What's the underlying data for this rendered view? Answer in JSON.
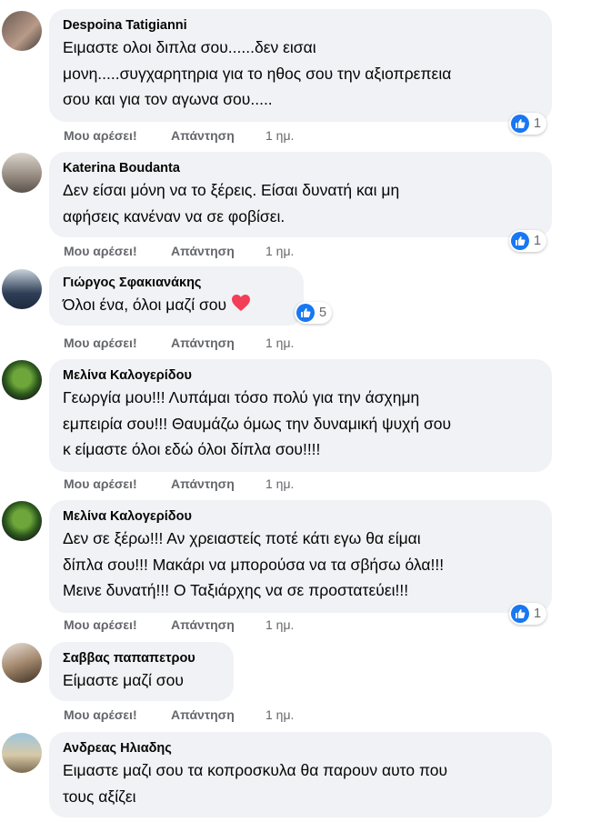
{
  "comments": [
    {
      "author": "Despoina Tatigianni",
      "lines": [
        "Ειμαστε ολοι διπλα σου......δεν εισαι",
        "μονη.....συγχαρητηρια για το ηθος σου την αξιοπρεπεια",
        "σου και για τον αγωνα σου....."
      ],
      "like_label": "Μου αρέσει!",
      "reply_label": "Απάντηση",
      "time": "1 ημ.",
      "reactions": "1"
    },
    {
      "author": "Katerina Boudanta",
      "lines": [
        "Δεν είσαι μόνη να το ξέρεις. Είσαι δυνατή και μη",
        "αφήσεις κανέναν να σε φοβίσει."
      ],
      "like_label": "Μου αρέσει!",
      "reply_label": "Απάντηση",
      "time": "1 ημ.",
      "reactions": "1"
    },
    {
      "author": "Γιώργος Σφακιανάκης",
      "lines": [
        "Όλοι ένα, όλοι μαζί σου"
      ],
      "like_label": "Μου αρέσει!",
      "reply_label": "Απάντηση",
      "time": "1 ημ.",
      "reactions": "5"
    },
    {
      "author": "Μελίνα Καλογερίδου",
      "lines": [
        "Γεωργία μου!!! Λυπάμαι τόσο πολύ για την άσχημη",
        "εμπειρία σου!!! Θαυμάζω όμως την δυναμική ψυχή σου",
        "κ είμαστε όλοι εδώ όλοι δίπλα σου!!!!"
      ],
      "like_label": "Μου αρέσει!",
      "reply_label": "Απάντηση",
      "time": "1 ημ."
    },
    {
      "author": "Μελίνα Καλογερίδου",
      "lines": [
        "Δεν σε ξέρω!!! Αν χρειαστείς ποτέ κάτι εγω θα είμαι",
        "δίπλα σου!!! Μακάρι να μπορούσα να τα σβήσω όλα!!!",
        "Μεινε δυνατή!!! Ο Ταξιάρχης να σε προστατεύει!!!"
      ],
      "like_label": "Μου αρέσει!",
      "reply_label": "Απάντηση",
      "time": "1 ημ.",
      "reactions": "1"
    },
    {
      "author": "Σαββας παπαπετρου",
      "lines": [
        "Είμαστε μαζί σου"
      ],
      "like_label": "Μου αρέσει!",
      "reply_label": "Απάντηση",
      "time": "1 ημ."
    },
    {
      "author": "Ανδρεας Ηλιαδης",
      "lines": [
        "Ειμαστε μαζι σου τα κοπροσκυλα θα παρουν αυτο που",
        "τους αξίζει"
      ]
    }
  ],
  "colors": {
    "bubble": "#f0f2f5",
    "like_blue": "#1877f2",
    "heart_red": "#f33e58",
    "muted_text": "#65676b"
  },
  "icons": {
    "reaction": "like-icon",
    "inline_emoji": "red-heart-icon"
  }
}
